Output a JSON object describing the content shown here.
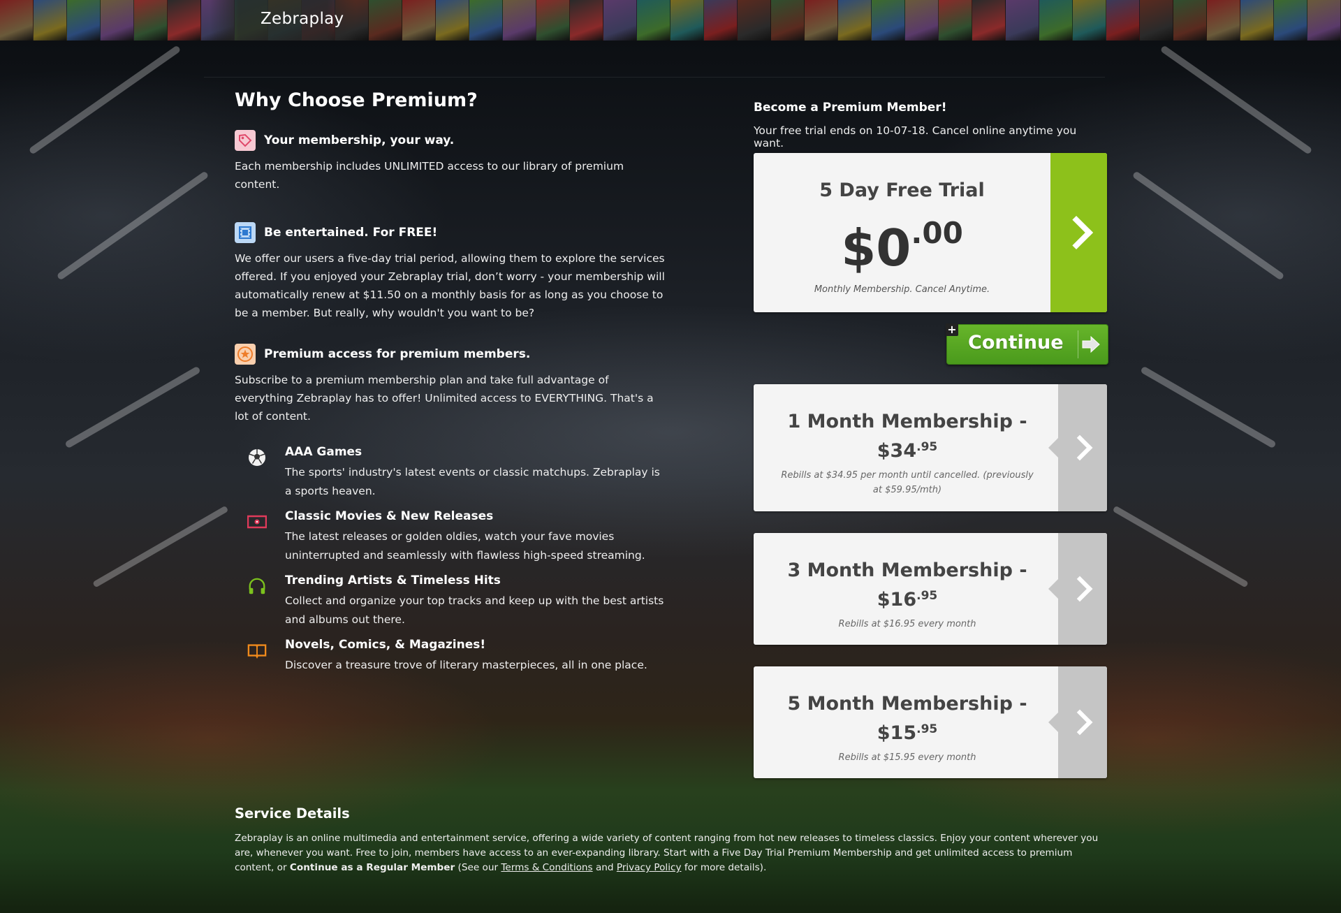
{
  "brand": {
    "name": "Zebraplay"
  },
  "left": {
    "heading": "Why Choose Premium?",
    "features": [
      {
        "icon": "tag-icon",
        "title": "Your membership, your way.",
        "text": "Each membership includes UNLIMITED access to our library of premium content."
      },
      {
        "icon": "film-icon",
        "title": "Be entertained. For FREE!",
        "text": "We offer our users a five-day trial period, allowing them to explore the services offered. If you enjoyed your Zebraplay trial, don’t worry - your membership will automatically renew at $11.50 on a monthly basis for as long as you choose to be a member. But really, why wouldn't you want to be?"
      },
      {
        "icon": "star-icon",
        "title": "Premium access for premium members.",
        "text": "Subscribe to a premium membership plan and take full advantage of everything Zebraplay has to offer! Unlimited access to EVERYTHING. That's a lot of content."
      }
    ],
    "items": [
      {
        "icon": "soccer-ball-icon",
        "title": "AAA Games",
        "text": "The sports' industry's latest events or classic matchups. Zebraplay is a sports heaven."
      },
      {
        "icon": "movie-ticket-icon",
        "title": "Classic Movies & New Releases",
        "text": "The latest releases or golden oldies, watch your fave movies uninterrupted and seamlessly with flawless high-speed streaming."
      },
      {
        "icon": "headphones-icon",
        "title": "Trending Artists & Timeless Hits",
        "text": "Collect and organize your top tracks and keep up with the best artists and albums out there."
      },
      {
        "icon": "book-icon",
        "title": "Novels, Comics, & Magazines!",
        "text": "Discover a treasure trove of literary masterpieces, all in one place."
      }
    ]
  },
  "right": {
    "heading": "Become a Premium Member!",
    "subheading": "Your free trial ends on 10-07-18. Cancel online anytime you want.",
    "trial": {
      "title": "5 Day Free Trial",
      "price_main": "$0",
      "price_cents": ".00",
      "note": "Monthly Membership. Cancel Anytime."
    },
    "continue": {
      "label": "Continue",
      "plus": "+"
    },
    "plans": [
      {
        "title": "1 Month Membership -",
        "price_main": "$34",
        "price_cents": ".95",
        "note": "Rebills at $34.95 per month until cancelled. (previously at $59.95/mth)"
      },
      {
        "title": "3 Month Membership -",
        "price_main": "$16",
        "price_cents": ".95",
        "note": "Rebills at $16.95 every month"
      },
      {
        "title": "5 Month Membership -",
        "price_main": "$15",
        "price_cents": ".95",
        "note": "Rebills at $15.95 every month"
      }
    ]
  },
  "service": {
    "heading": "Service Details",
    "text_1": "Zebraplay is an online multimedia and entertainment service, offering a wide variety of content ranging from hot new releases to timeless classics. Enjoy your content wherever you are, whenever you want. Free to join, members have access to an ever-expanding library. Start with a Five Day Trial Premium Membership and get unlimited access to premium content, or",
    "bold": "Continue as a Regular Member",
    "text_2": "(See our",
    "terms_link": "Terms & Conditions",
    "and": "and",
    "privacy_link": "Privacy Policy",
    "text_3": "for more details)."
  },
  "colors": {
    "accent_green": "#8dc11b",
    "button_green": "#4a9a1c",
    "card_bg": "#f4f4f4",
    "card_arrow": "#c5c5c5"
  }
}
